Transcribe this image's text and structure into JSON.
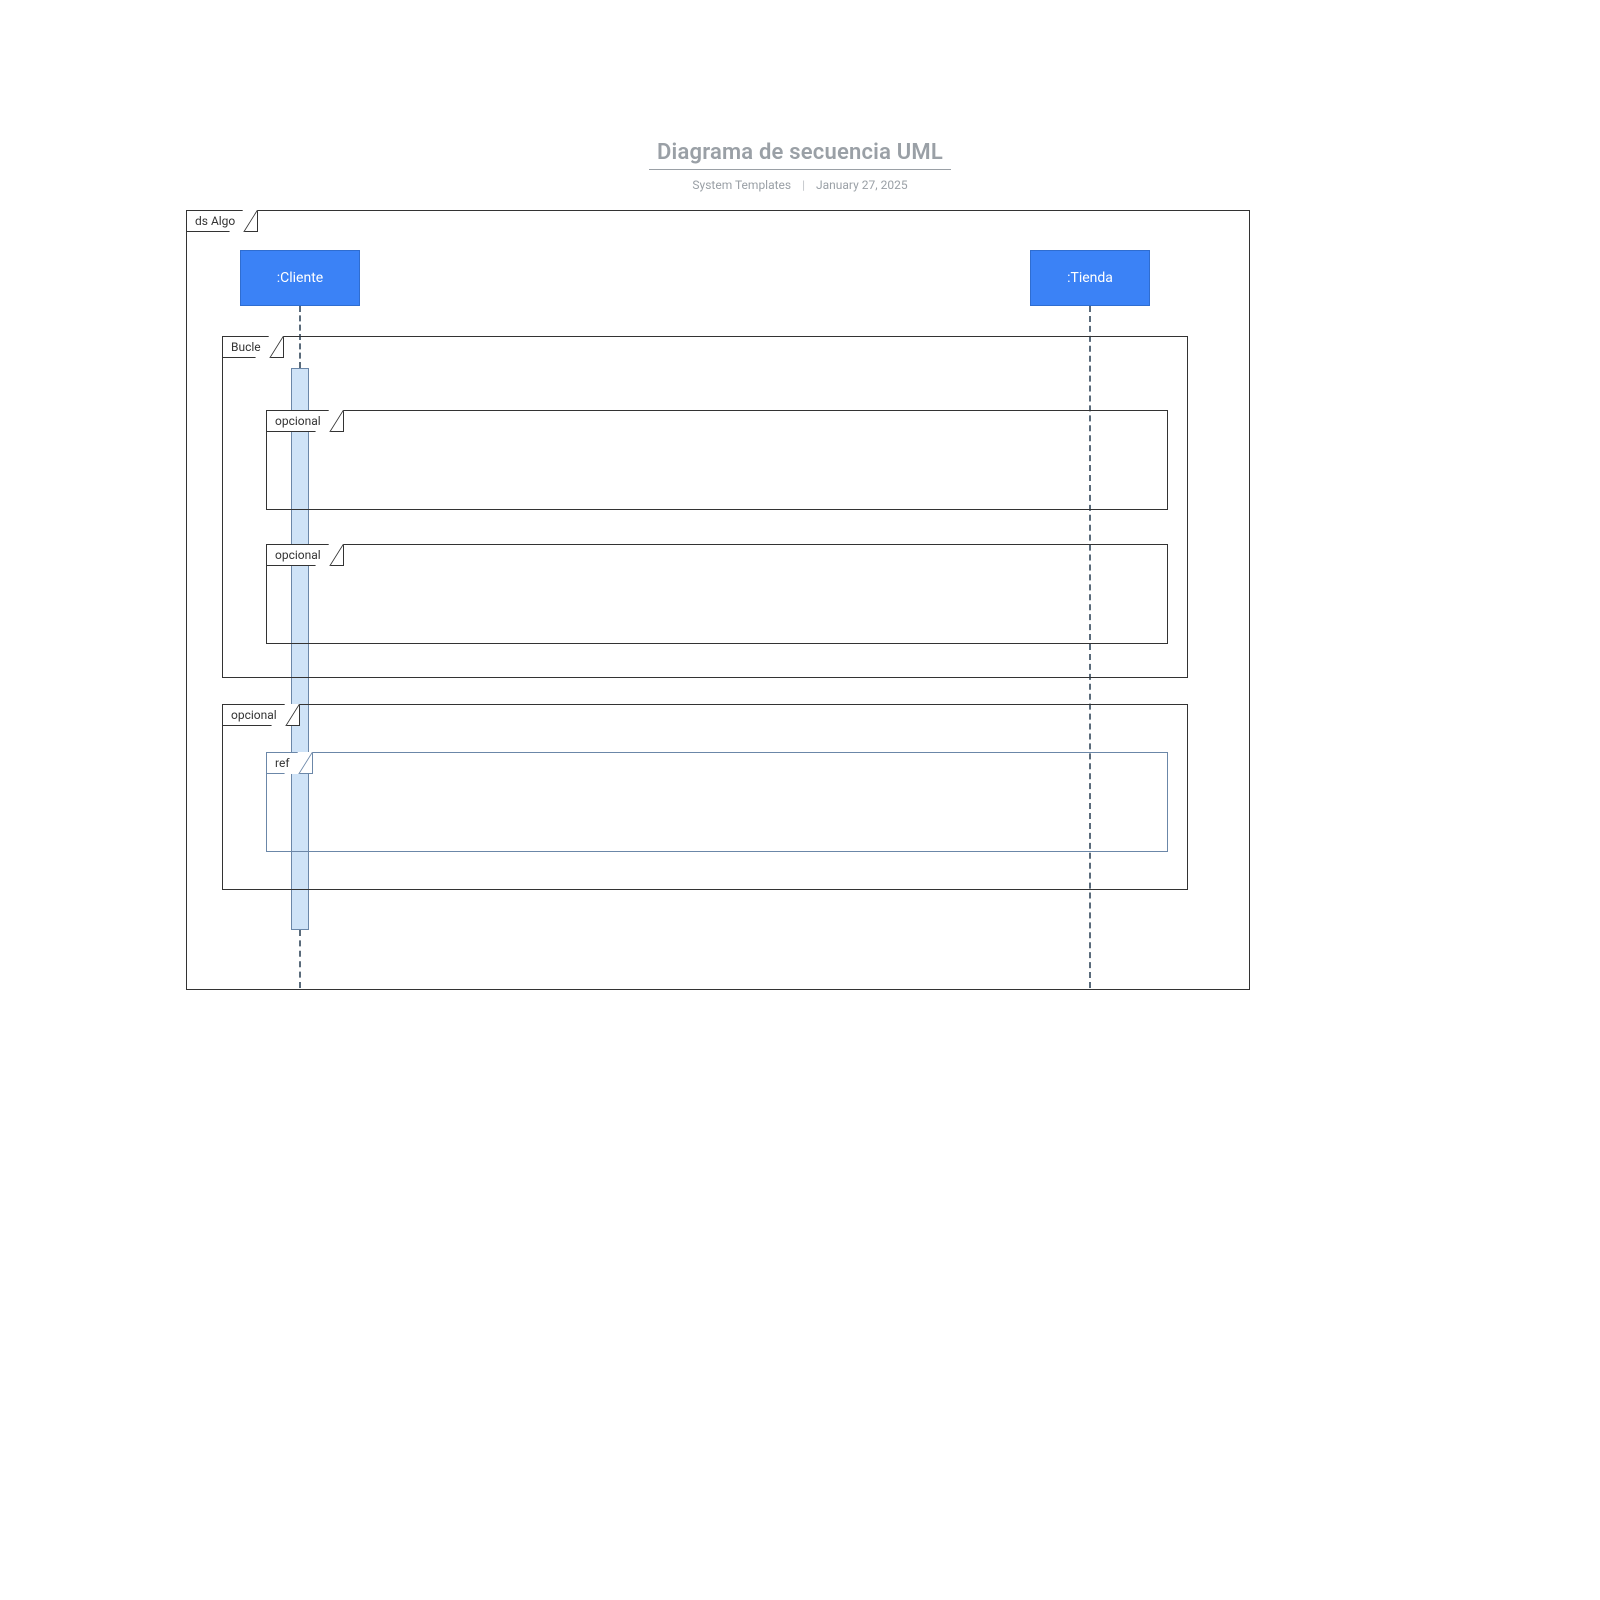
{
  "title": "Diagrama de secuencia UML",
  "subtitle_author": "System Templates",
  "subtitle_date": "January 27, 2025",
  "frames": {
    "outer": "ds Algo",
    "loop": "Bucle",
    "opt1": "opcional",
    "opt2": "opcional",
    "opt3": "opcional",
    "ref": "ref"
  },
  "lifelines": {
    "client": ":Cliente",
    "store": ":Tienda"
  },
  "colors": {
    "lifeline_fill": "#3b82f6",
    "activation_fill": "#cfe3f7",
    "frame_border": "#333333",
    "ref_border": "#6b87a8"
  }
}
